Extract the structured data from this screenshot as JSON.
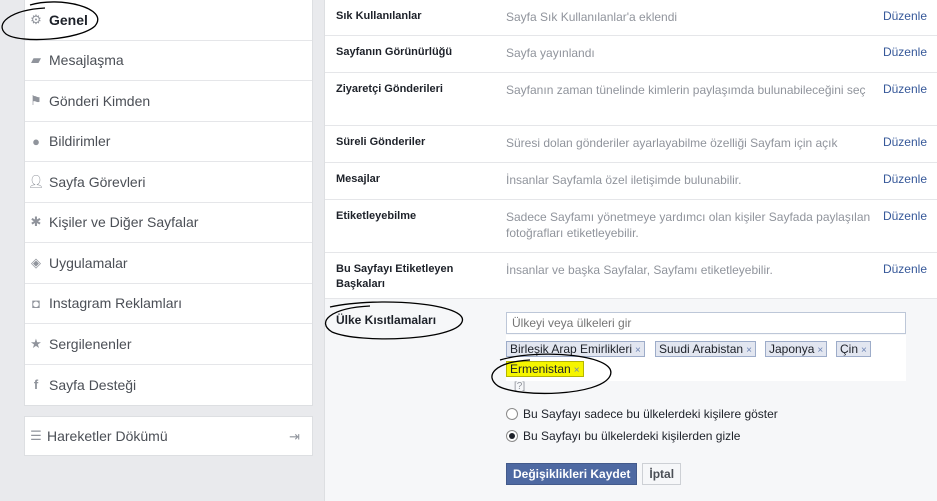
{
  "sidebar": {
    "items": [
      {
        "label": "Genel",
        "icon": "gear-icon",
        "active": true
      },
      {
        "label": "Mesajlaşma",
        "icon": "chat-icon"
      },
      {
        "label": "Gönderi Kimden",
        "icon": "flag-icon"
      },
      {
        "label": "Bildirimler",
        "icon": "globe-icon"
      },
      {
        "label": "Sayfa Görevleri",
        "icon": "person-icon"
      },
      {
        "label": "Kişiler ve Diğer Sayfalar",
        "icon": "people-icon"
      },
      {
        "label": "Uygulamalar",
        "icon": "box-icon"
      },
      {
        "label": "Instagram Reklamları",
        "icon": "instagram-icon"
      },
      {
        "label": "Sergilenenler",
        "icon": "star-icon"
      },
      {
        "label": "Sayfa Desteği",
        "icon": "facebook-icon"
      }
    ],
    "activity_log": "Hareketler Dökümü"
  },
  "settings": {
    "edit_label": "Düzenle",
    "rows": [
      {
        "label": "Sık Kullanılanlar",
        "value": "Sayfa Sık Kullanılanlar'a eklendi"
      },
      {
        "label": "Sayfanın Görünürlüğü",
        "value": "Sayfa yayınlandı"
      },
      {
        "label": "Ziyaretçi Gönderileri",
        "value": "Sayfanın zaman tünelinde kimlerin paylaşımda bulunabileceğini seç"
      },
      {
        "label": "Süreli Gönderiler",
        "value": "Süresi dolan gönderiler ayarlayabilme özelliği Sayfam için açık"
      },
      {
        "label": "Mesajlar",
        "value": "İnsanlar Sayfamla özel iletişimde bulunabilir."
      },
      {
        "label": "Etiketleyebilme",
        "value": "Sadece Sayfamı yönetmeye yardımcı olan kişiler Sayfada paylaşılan fotoğrafları etiketleyebilir."
      },
      {
        "label": "Bu Sayfayı Etiketleyen Başkaları",
        "value": "İnsanlar ve başka Sayfalar, Sayfamı etiketleyebilir."
      }
    ]
  },
  "country": {
    "label": "Ülke Kısıtlamaları",
    "placeholder": "Ülkeyi veya ülkeleri gir",
    "tokens": [
      "Birleşik Arap Emirlikleri",
      "Suudi Arabistan",
      "Japonya",
      "Çin",
      "Ermenistan"
    ],
    "remove_glyph": "×",
    "help": "[?]",
    "option_show": "Bu Sayfayı sadece bu ülkelerdeki kişilere göster",
    "option_hide": "Bu Sayfayı bu ülkelerdeki kişilerden gizle",
    "selected_option": "hide",
    "save_label": "Değişiklikleri Kaydet",
    "cancel_label": "İptal"
  },
  "colors": {
    "link": "#365899",
    "primary_button": "#4e69a2",
    "highlight": "#f5f500"
  }
}
